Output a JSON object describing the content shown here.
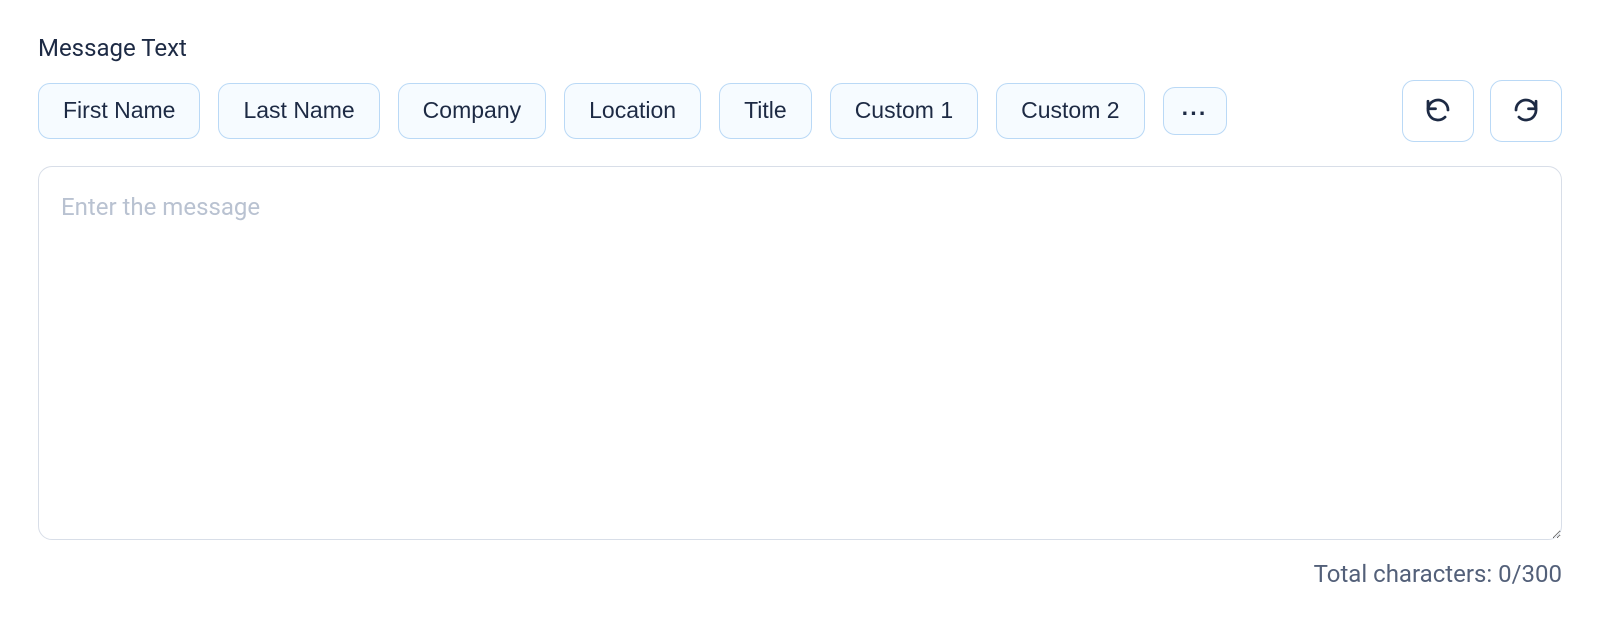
{
  "section": {
    "label": "Message Text"
  },
  "chips": [
    "First Name",
    "Last Name",
    "Company",
    "Location",
    "Title",
    "Custom 1",
    "Custom 2"
  ],
  "more_label": "···",
  "message": {
    "placeholder": "Enter the message",
    "value": ""
  },
  "counter": {
    "prefix": "Total characters: ",
    "current": 0,
    "max": 300
  }
}
